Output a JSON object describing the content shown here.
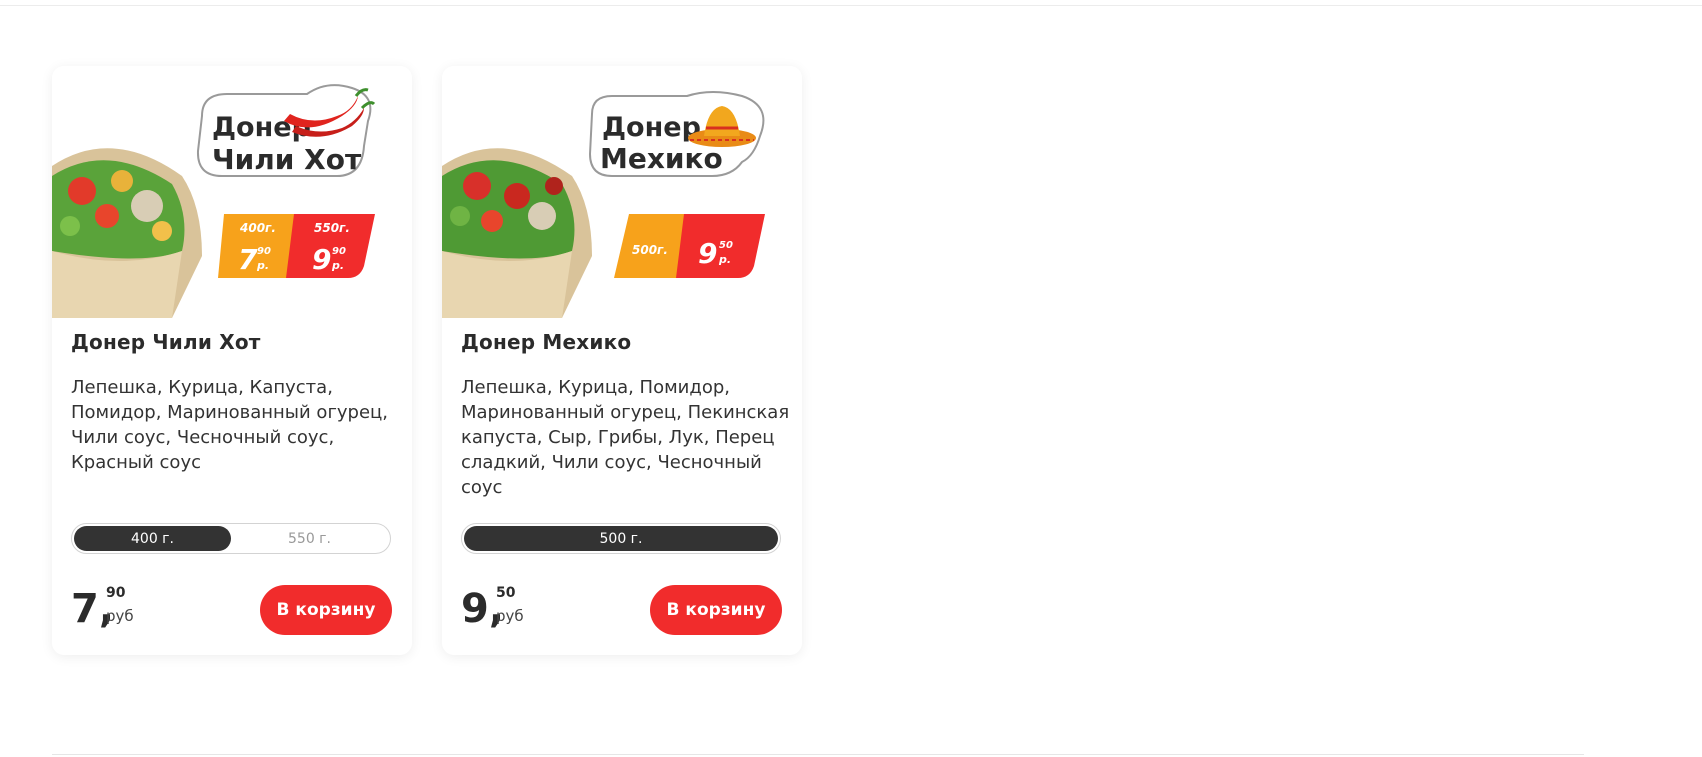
{
  "products": [
    {
      "name": "Донер Чили Хот",
      "ingredients": "Лепешка, Курица, Капуста, Помидор, Маринованный огурец, Чили соус, Чесночный соус, Красный соус",
      "logo_line1": "Донер",
      "logo_line2": "Чили Хот",
      "badge": [
        {
          "weight": "400г.",
          "price_int": "7",
          "price_dec": "90",
          "unit": "р."
        },
        {
          "weight": "550г.",
          "price_int": "9",
          "price_dec": "90",
          "unit": "р."
        }
      ],
      "sizes": [
        {
          "label": "400 г.",
          "selected": true
        },
        {
          "label": "550 г.",
          "selected": false
        }
      ],
      "price_int": "7,",
      "price_dec": "90",
      "currency": "руб",
      "button": "В корзину",
      "logo_icon": "chili-pepper-icon"
    },
    {
      "name": "Донер Мехико",
      "ingredients": "Лепешка, Курица, Помидор, Маринованный огурец, Пекинская капуста, Сыр, Грибы, Лук, Перец сладкий, Чили соус, Чесночный соус",
      "logo_line1": "Донер",
      "logo_line2": "Мехико",
      "badge": [
        {
          "weight": "500г.",
          "price_int": "9",
          "price_dec": "50",
          "unit": "р."
        }
      ],
      "sizes": [
        {
          "label": "500 г.",
          "selected": true
        }
      ],
      "price_int": "9,",
      "price_dec": "50",
      "currency": "руб",
      "button": "В корзину",
      "logo_icon": "sombrero-icon"
    }
  ],
  "colors": {
    "accent_red": "#f12c2c",
    "badge_orange": "#f7a21b",
    "dark_pill": "#333333"
  }
}
